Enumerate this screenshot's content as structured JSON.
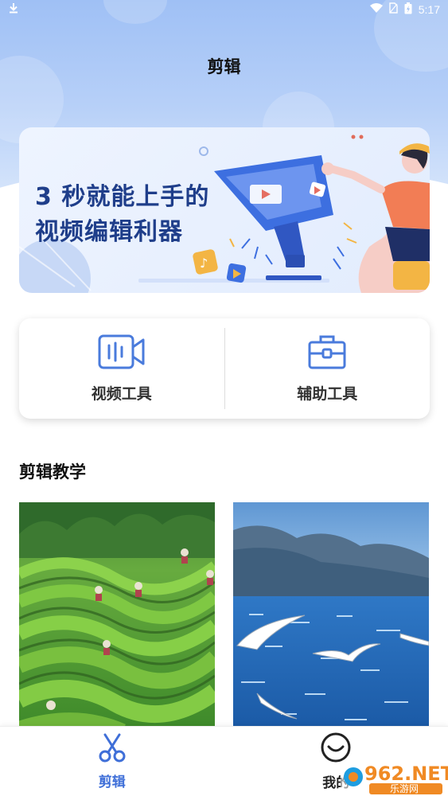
{
  "status_bar": {
    "time": "5:17"
  },
  "header": {
    "title": "剪辑"
  },
  "banner": {
    "line1": "3 秒就能上手的",
    "line2": "视频编辑利器"
  },
  "tools": [
    {
      "label": "视频工具",
      "icon": "video-camera-icon"
    },
    {
      "label": "辅助工具",
      "icon": "toolbox-icon"
    }
  ],
  "section": {
    "title": "剪辑教学"
  },
  "tutorials": [
    {
      "image": "tea-plantation-image"
    },
    {
      "image": "sea-seagulls-image"
    }
  ],
  "bottom_nav": [
    {
      "label": "剪辑",
      "icon": "scissors-icon",
      "active": true
    },
    {
      "label": "我的",
      "icon": "smile-icon",
      "active": false
    }
  ],
  "watermark": {
    "brand": "962.NET",
    "sub": "乐游网"
  },
  "colors": {
    "accent": "#4a7bdc",
    "header_bg": "#a9c7f6",
    "banner_text": "#1f3e8a",
    "nav_active": "#3f6fd8"
  }
}
